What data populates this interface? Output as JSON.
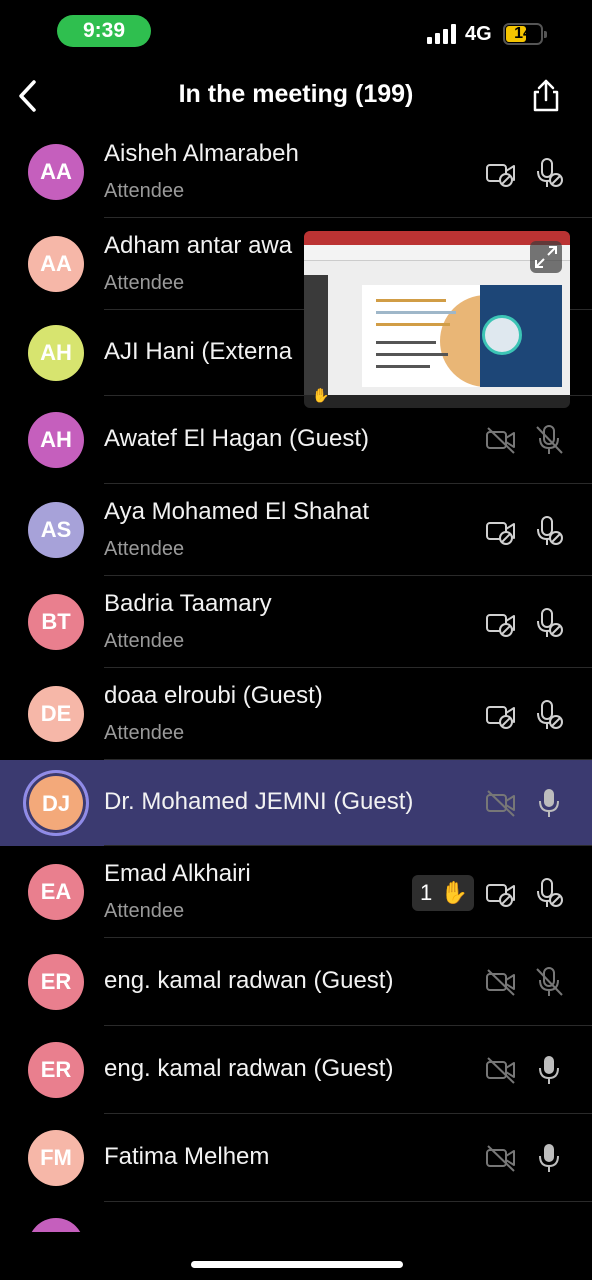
{
  "status_bar": {
    "time": "9:39",
    "network": "4G",
    "battery": "14"
  },
  "header": {
    "title": "In the meeting (199)"
  },
  "colors": {
    "highlight": "#3b3a70",
    "accent": "#8f8be8",
    "role_text": "#9a9a9a"
  },
  "participants": [
    {
      "initials": "AA",
      "name": "Aisheh Almarabeh",
      "role": "Attendee",
      "avatar_color": "#c55fbd",
      "cam": "camera-off-icon",
      "mic": "mic-off-icon"
    },
    {
      "initials": "AA",
      "name": "Adham antar awa",
      "role": "Attendee",
      "avatar_color": "#f6b7a8",
      "cam": "",
      "mic": ""
    },
    {
      "initials": "AH",
      "name": "AJI Hani (Externa",
      "role": "",
      "avatar_color": "#d7e46f",
      "cam": "",
      "mic": ""
    },
    {
      "initials": "AH",
      "name": "Awatef El Hagan (Guest)",
      "role": "",
      "avatar_color": "#c55fbd",
      "cam": "camera-disabled-icon",
      "mic": "mic-disabled-icon"
    },
    {
      "initials": "AS",
      "name": "Aya Mohamed El Shahat",
      "role": "Attendee",
      "avatar_color": "#a7a2d9",
      "cam": "camera-off-icon",
      "mic": "mic-off-icon"
    },
    {
      "initials": "BT",
      "name": "Badria Taamary",
      "role": "Attendee",
      "avatar_color": "#e97f8e",
      "cam": "camera-off-icon",
      "mic": "mic-off-icon"
    },
    {
      "initials": "DE",
      "name": "doaa elroubi  (Guest)",
      "role": "Attendee",
      "avatar_color": "#f6b7a8",
      "cam": "camera-off-icon",
      "mic": "mic-off-icon"
    },
    {
      "initials": "DJ",
      "name": "Dr. Mohamed JEMNI (Guest)",
      "role": "",
      "avatar_color": "#f3a97a",
      "cam": "camera-disabled-icon",
      "mic": "mic-icon"
    },
    {
      "initials": "EA",
      "name": "Emad Alkhairi",
      "role": "Attendee",
      "avatar_color": "#e97f8e",
      "cam": "camera-off-icon",
      "mic": "mic-off-icon",
      "hand_count": "1"
    },
    {
      "initials": "ER",
      "name": "eng. kamal radwan (Guest)",
      "role": "",
      "avatar_color": "#e97f8e",
      "cam": "camera-disabled-icon",
      "mic": "mic-disabled-icon"
    },
    {
      "initials": "ER",
      "name": "eng. kamal radwan (Guest)",
      "role": "",
      "avatar_color": "#e97f8e",
      "cam": "camera-disabled-icon",
      "mic": "mic-icon"
    },
    {
      "initials": "FM",
      "name": "Fatima Melhem",
      "role": "",
      "avatar_color": "#f6b7a8",
      "cam": "camera-disabled-icon",
      "mic": "mic-icon"
    }
  ]
}
